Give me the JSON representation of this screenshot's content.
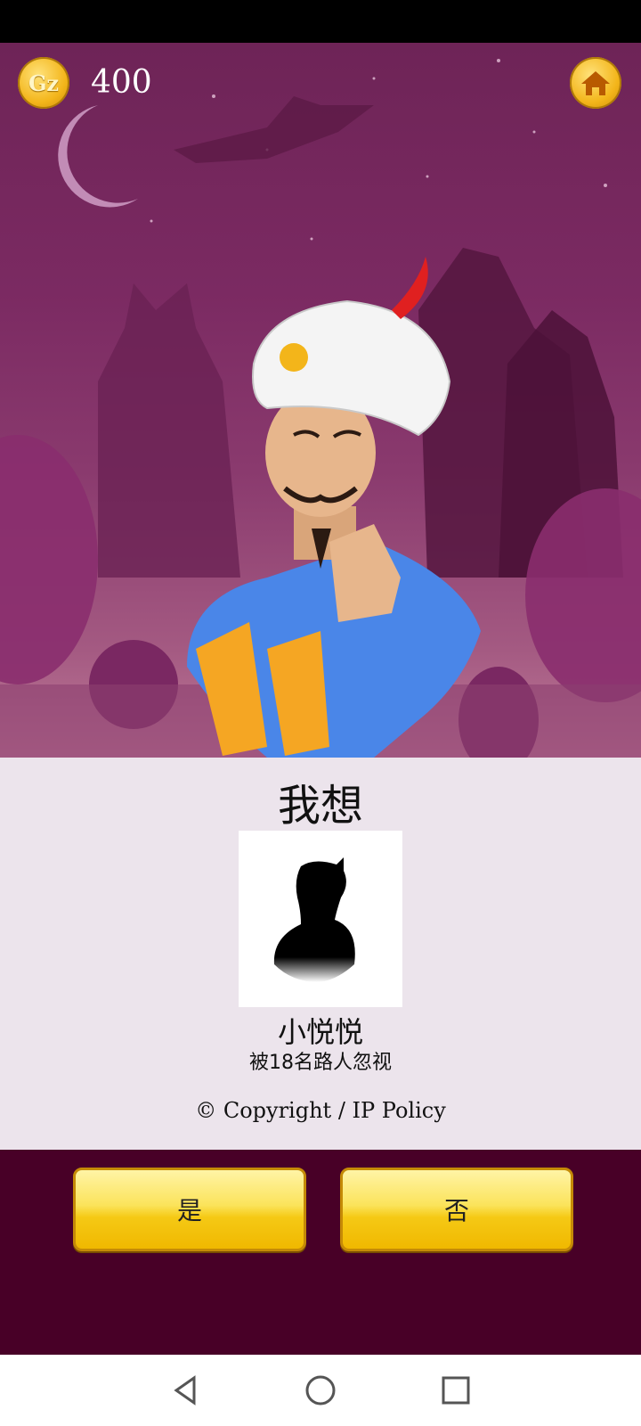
{
  "header": {
    "coin_icon_text": "Gz",
    "coin_count": "400",
    "home_icon": "home-icon"
  },
  "panel": {
    "title": "我想",
    "character_name": "小悦悦",
    "character_subtitle": "被18名路人忽视",
    "copyright": "© Copyright / IP Policy"
  },
  "buttons": {
    "yes_label": "是",
    "no_label": "否"
  },
  "navbar": {
    "back_icon": "back-triangle-icon",
    "home_icon": "circle-home-icon",
    "recents_icon": "square-recents-icon"
  },
  "colors": {
    "sky": "#7b2a62",
    "panel": "#ece4ec",
    "bottom": "#480027",
    "button_gold": "#f5c915"
  }
}
